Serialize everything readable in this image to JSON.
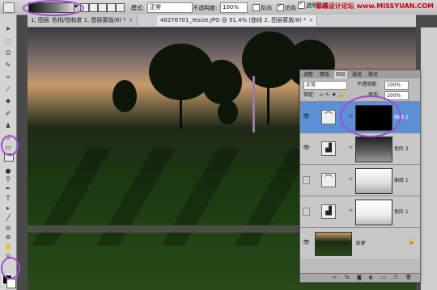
{
  "options_bar": {
    "mode_label": "模式:",
    "mode_value": "正常",
    "opacity_label": "不透明度:",
    "opacity_value": "100%",
    "reverse_label": "反向",
    "dither_label": "仿色",
    "transparency_label": "透明区域"
  },
  "watermark": "思缘设计论坛 www.MISSYUAN.COM",
  "doc_tabs": [
    {
      "label": "1, 图层 1, 图层蒙版/8) *"
    },
    {
      "label": "色相/饱和度 1, 图层蒙版/8) *"
    },
    {
      "label": "482Y6701_resize.JPG @ 91.4% (曲线 2, 图层蒙版/8) *"
    }
  ],
  "layers_panel": {
    "tabs": [
      "调整",
      "蒙版",
      "图层",
      "通道",
      "路径"
    ],
    "blend_mode": "正常",
    "opacity_label": "不透明度:",
    "opacity_value": "100%",
    "lock_label": "锁定:",
    "fill_label": "填充:",
    "fill_value": "100%",
    "layers": [
      {
        "name": "曲线 2",
        "selected": true,
        "visible": true,
        "type": "curves-icon"
      },
      {
        "name": "色阶 2",
        "selected": false,
        "visible": true,
        "type": "levels-icon"
      },
      {
        "name": "曲线 1",
        "selected": false,
        "visible": false,
        "type": "curves-icon"
      },
      {
        "name": "色阶 1",
        "selected": false,
        "visible": false,
        "type": "levels-icon"
      },
      {
        "name": "背景",
        "selected": false,
        "visible": true,
        "type": "background"
      }
    ]
  },
  "colors": {
    "highlight_ring": "#a04cd0",
    "selected_layer": "#5b8fd6"
  }
}
